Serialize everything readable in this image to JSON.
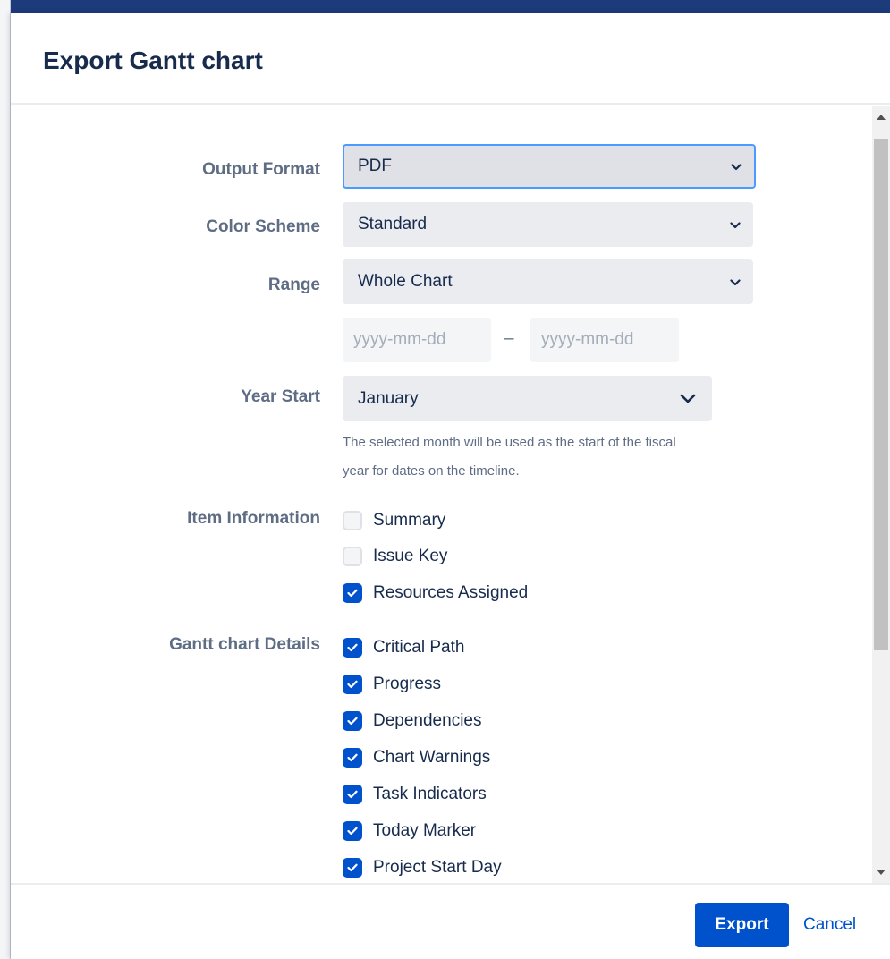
{
  "dialog": {
    "title": "Export Gantt chart"
  },
  "form": {
    "output_format": {
      "label": "Output Format",
      "value": "PDF"
    },
    "color_scheme": {
      "label": "Color Scheme",
      "value": "Standard"
    },
    "range": {
      "label": "Range",
      "value": "Whole Chart"
    },
    "date_range": {
      "start_placeholder": "yyyy-mm-dd",
      "separator": "–",
      "end_placeholder": "yyyy-mm-dd"
    },
    "year_start": {
      "label": "Year Start",
      "value": "January",
      "help_line1": "The selected month will be used as the start of the fiscal",
      "help_line2": "year for dates on the timeline."
    },
    "item_information": {
      "label": "Item Information",
      "options": [
        {
          "label": "Summary",
          "checked": false
        },
        {
          "label": "Issue Key",
          "checked": false
        },
        {
          "label": "Resources Assigned",
          "checked": true
        }
      ]
    },
    "gantt_details": {
      "label": "Gantt chart Details",
      "options": [
        {
          "label": "Critical Path",
          "checked": true
        },
        {
          "label": "Progress",
          "checked": true
        },
        {
          "label": "Dependencies",
          "checked": true
        },
        {
          "label": "Chart Warnings",
          "checked": true
        },
        {
          "label": "Task Indicators",
          "checked": true
        },
        {
          "label": "Today Marker",
          "checked": true
        },
        {
          "label": "Project Start Day",
          "checked": true
        }
      ]
    }
  },
  "footer": {
    "export_label": "Export",
    "cancel_label": "Cancel"
  },
  "colors": {
    "primary": "#0052cc",
    "focus_ring": "#4c9aff",
    "header_band": "#1d3a7a",
    "label_text": "#5e6c84"
  },
  "icons": {
    "chevron": "chevron-down-icon",
    "check": "check-icon"
  }
}
